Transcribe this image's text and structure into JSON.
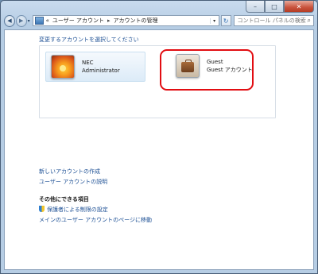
{
  "window": {
    "minimize_glyph": "–",
    "maximize_glyph": "□",
    "close_glyph": "✕"
  },
  "nav": {
    "back_glyph": "◀",
    "forward_glyph": "▶",
    "history_glyph": "▾",
    "breadcrumb_overflow": "«",
    "breadcrumb_separator": "▸",
    "breadcrumb": [
      "ユーザー アカウント",
      "アカウントの管理"
    ],
    "address_dropdown_glyph": "▾",
    "refresh_glyph": "↻",
    "search_placeholder": "コントロール パネルの検索",
    "search_glyph": "⌕"
  },
  "main": {
    "instruction": "変更するアカウントを選択してください",
    "accounts": [
      {
        "name": "NEC",
        "type": "Administrator",
        "picture": "flower-icon"
      },
      {
        "name": "Guest",
        "type": "Guest アカウント",
        "picture": "briefcase-icon"
      }
    ],
    "links": [
      "新しいアカウントの作成",
      "ユーザー アカウントの説明"
    ],
    "additional_heading": "その他にできる項目",
    "additional_links": [
      {
        "label": "保護者による制限の設定",
        "icon": "shield-icon"
      },
      {
        "label": "メインのユーザー アカウントのページに移動"
      }
    ]
  },
  "colors": {
    "link": "#1c4f94",
    "highlight": "#e20d12"
  }
}
